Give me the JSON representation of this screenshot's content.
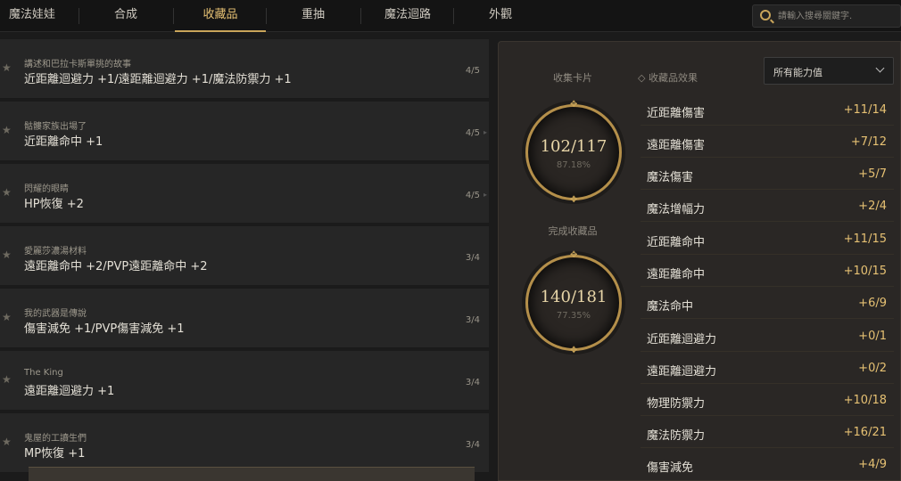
{
  "tabs": [
    {
      "label": "魔法娃娃",
      "active": false
    },
    {
      "label": "合成",
      "active": false
    },
    {
      "label": "收藏品",
      "active": true
    },
    {
      "label": "重抽",
      "active": false
    },
    {
      "label": "魔法迴路",
      "active": false
    },
    {
      "label": "外觀",
      "active": false
    }
  ],
  "search": {
    "placeholder": "請輸入搜尋關鍵字."
  },
  "collections": [
    {
      "name": "講述和巴拉卡斯單挑的故事",
      "effect": "近距離迴避力 +1/遠距離迴避力 +1/魔法防禦力 +1",
      "count": "4/5"
    },
    {
      "name": "骷髏家族出場了",
      "effect": "近距離命中 +1",
      "count": "4/5"
    },
    {
      "name": "閃耀的眼睛",
      "effect": "HP恢復 +2",
      "count": "4/5"
    },
    {
      "name": "愛麗莎濃湯材料",
      "effect": "遠距離命中 +2/PVP遠距離命中 +2",
      "count": "3/4"
    },
    {
      "name": "我的武器是傳說",
      "effect": "傷害減免 +1/PVP傷害減免 +1",
      "count": "3/4"
    },
    {
      "name": "The King",
      "effect": "遠距離迴避力 +1",
      "count": "3/4"
    },
    {
      "name": "鬼屋的工讀生們",
      "effect": "MP恢復 +1",
      "count": "3/4"
    }
  ],
  "summary": {
    "cards_title": "收集卡片",
    "cards_value": "102/117",
    "cards_pct": "87.18%",
    "complete_title": "完成收藏品",
    "complete_value": "140/181",
    "complete_pct": "77.35%"
  },
  "effects": {
    "header": "收藏品效果",
    "filter": "所有能力值",
    "stats": [
      {
        "name": "近距離傷害",
        "value": "+11/14"
      },
      {
        "name": "遠距離傷害",
        "value": "+7/12"
      },
      {
        "name": "魔法傷害",
        "value": "+5/7"
      },
      {
        "name": "魔法增幅力",
        "value": "+2/4"
      },
      {
        "name": "近距離命中",
        "value": "+11/15"
      },
      {
        "name": "遠距離命中",
        "value": "+10/15"
      },
      {
        "name": "魔法命中",
        "value": "+6/9"
      },
      {
        "name": "近距離迴避力",
        "value": "+0/1"
      },
      {
        "name": "遠距離迴避力",
        "value": "+0/2"
      },
      {
        "name": "物理防禦力",
        "value": "+10/18"
      },
      {
        "name": "魔法防禦力",
        "value": "+16/21"
      },
      {
        "name": "傷害減免",
        "value": "+4/9"
      }
    ]
  }
}
